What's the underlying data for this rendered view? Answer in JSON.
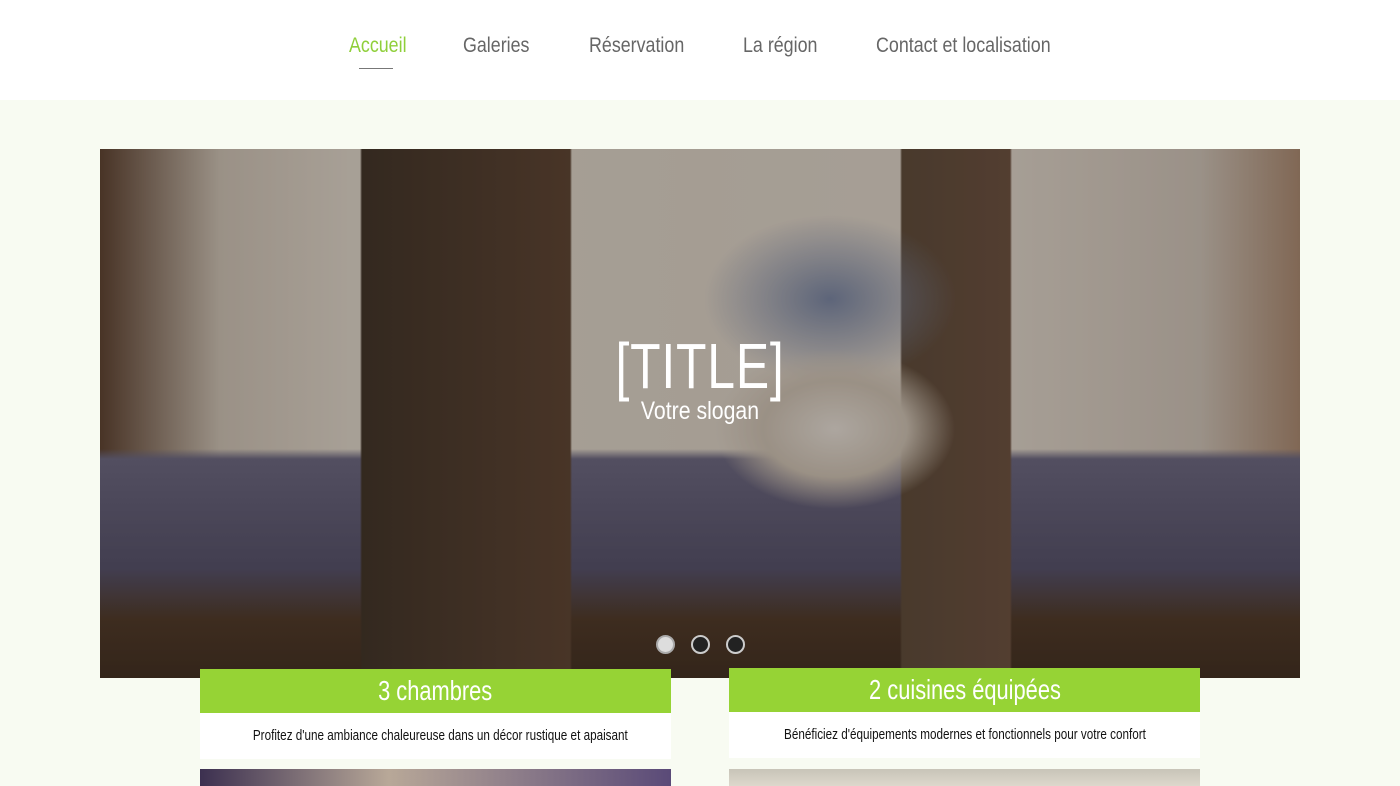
{
  "nav": {
    "items": [
      {
        "label": "Accueil",
        "active": true
      },
      {
        "label": "Galeries"
      },
      {
        "label": "Réservation"
      },
      {
        "label": "La région"
      },
      {
        "label": "Contact et localisation"
      }
    ],
    "accent": "#8fcf3a"
  },
  "hero": {
    "title": "[TITLE]",
    "slogan": "Votre slogan",
    "slides": 3,
    "active_slide": 1
  },
  "cards": [
    {
      "title": "3 chambres",
      "text": "Profitez d'une ambiance chaleureuse dans un décor rustique et apaisant"
    },
    {
      "title": "2 cuisines équipées",
      "text": "Bénéficiez d'équipements modernes et fonctionnels pour votre confort"
    }
  ],
  "colors": {
    "card_header": "#96d335",
    "background": "#f8fbf2"
  }
}
